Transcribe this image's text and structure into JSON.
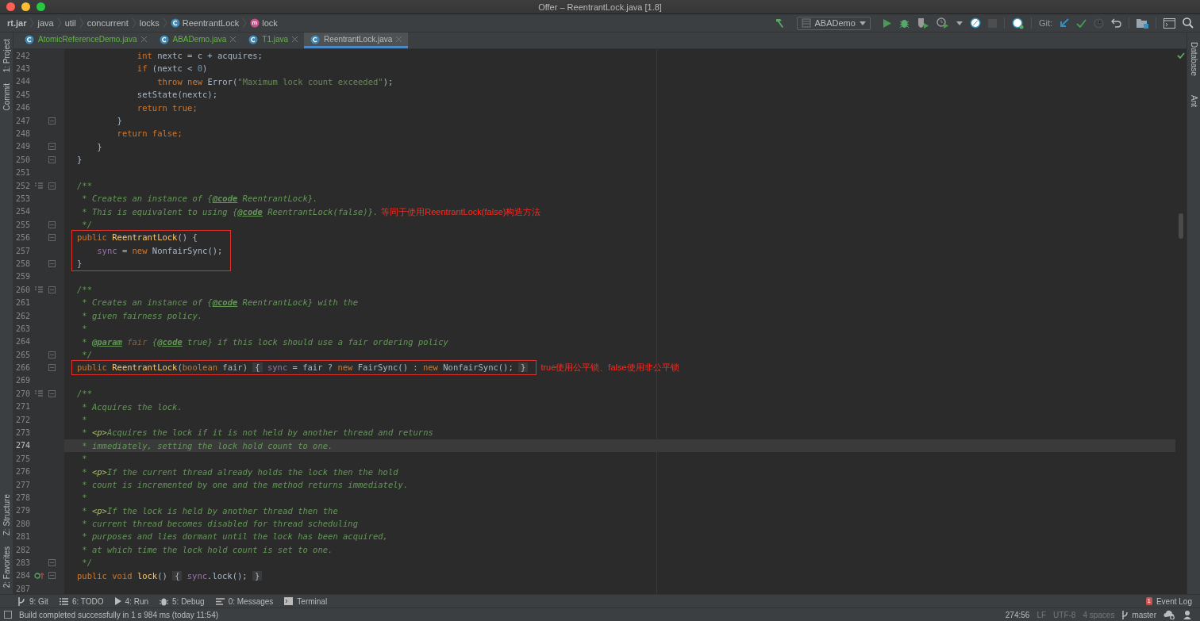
{
  "window": {
    "title": "Offer – ReentrantLock.java [1.8]"
  },
  "breadcrumbs": [
    {
      "label": "rt.jar",
      "kind": "root"
    },
    {
      "label": "java",
      "kind": "package"
    },
    {
      "label": "util",
      "kind": "package"
    },
    {
      "label": "concurrent",
      "kind": "package"
    },
    {
      "label": "locks",
      "kind": "package"
    },
    {
      "label": "ReentrantLock",
      "kind": "class"
    },
    {
      "label": "lock",
      "kind": "method"
    }
  ],
  "toolbar": {
    "run_config": "ABADemo",
    "git_label": "Git:"
  },
  "tabs": [
    {
      "label": "AtomicReferenceDemo.java",
      "selected": false,
      "color": "#62b543"
    },
    {
      "label": "ABADemo.java",
      "selected": false,
      "color": "#62b543"
    },
    {
      "label": "T1.java",
      "selected": false,
      "color": "#62b543"
    },
    {
      "label": "ReentrantLock.java",
      "selected": true,
      "color": "#bbbbbb"
    }
  ],
  "left_tool_windows": {
    "top": [
      "1: Project",
      "Commit"
    ],
    "bottom": [
      "Z: Structure",
      "2: Favorites"
    ]
  },
  "right_tool_windows": [
    "Database",
    "Ant"
  ],
  "editor": {
    "code": [
      {
        "kind": "line",
        "no": "242",
        "tokens": [
          {
            "text": "            int ",
            "kind": "kw"
          },
          {
            "text": "nextc = c + acquires;",
            "kind": "plain"
          }
        ]
      },
      {
        "kind": "line",
        "no": "243",
        "tokens": [
          {
            "text": "            if ",
            "kind": "kw"
          },
          {
            "text": "(nextc < ",
            "kind": "plain"
          },
          {
            "text": "0",
            "kind": "num"
          },
          {
            "text": ")",
            "kind": "plain"
          }
        ]
      },
      {
        "kind": "line",
        "no": "244",
        "tokens": [
          {
            "text": "                throw new ",
            "kind": "kw"
          },
          {
            "text": "Error(",
            "kind": "plain"
          },
          {
            "text": "\"Maximum lock count exceeded\"",
            "kind": "str"
          },
          {
            "text": ");",
            "kind": "plain"
          }
        ]
      },
      {
        "kind": "line",
        "no": "245",
        "tokens": [
          {
            "text": "            setState(nextc);",
            "kind": "plain"
          }
        ]
      },
      {
        "kind": "line",
        "no": "246",
        "tokens": [
          {
            "text": "            return true;",
            "kind": "kw"
          }
        ]
      },
      {
        "kind": "line",
        "no": "247",
        "gutter": [
          {
            "kind": "fold"
          }
        ],
        "tokens": [
          {
            "text": "        }",
            "kind": "plain"
          }
        ]
      },
      {
        "kind": "line",
        "no": "248",
        "tokens": [
          {
            "text": "        return false;",
            "kind": "kw"
          }
        ]
      },
      {
        "kind": "line",
        "no": "249",
        "gutter": [
          {
            "kind": "fold"
          }
        ],
        "tokens": [
          {
            "text": "    }",
            "kind": "plain"
          }
        ]
      },
      {
        "kind": "line",
        "no": "250",
        "gutter": [
          {
            "kind": "fold"
          }
        ],
        "tokens": [
          {
            "text": "}",
            "kind": "plain"
          }
        ]
      },
      {
        "kind": "line",
        "no": "251"
      },
      {
        "kind": "line",
        "no": "252",
        "gutter": [
          {
            "kind": "doc"
          },
          {
            "kind": "fold"
          }
        ],
        "tokens": [
          {
            "text": "/**",
            "kind": "doc"
          }
        ]
      },
      {
        "kind": "line",
        "no": "253",
        "tokens": [
          {
            "text": " * Creates an instance of {",
            "kind": "doc"
          },
          {
            "text": "@code",
            "kind": "doctag"
          },
          {
            "text": " ReentrantLock}.",
            "kind": "doc"
          }
        ]
      },
      {
        "kind": "line",
        "no": "254",
        "tokens": [
          {
            "text": " * This is equivalent to using {",
            "kind": "doc"
          },
          {
            "text": "@code",
            "kind": "doctag"
          },
          {
            "text": " ReentrantLock(false)}.",
            "kind": "doc"
          }
        ],
        "note": "等同于使用ReentrantLock(false)构造方法"
      },
      {
        "kind": "line",
        "no": "255",
        "gutter": [
          {
            "kind": "fold"
          }
        ],
        "tokens": [
          {
            "text": " */",
            "kind": "doc"
          }
        ]
      },
      {
        "kind": "boxed",
        "lines": [
          {
            "no": "256",
            "gutter": [
              {
                "kind": "fold"
              }
            ],
            "tokens": [
              {
                "text": "public ",
                "kind": "kw"
              },
              {
                "text": "ReentrantLock",
                "kind": "method"
              },
              {
                "text": "() {",
                "kind": "plain"
              }
            ]
          },
          {
            "no": "257",
            "tokens": [
              {
                "text": "    sync",
                "kind": "field"
              },
              {
                "text": " = ",
                "kind": "plain"
              },
              {
                "text": "new ",
                "kind": "kw"
              },
              {
                "text": "NonfairSync();",
                "kind": "plain"
              }
            ]
          },
          {
            "no": "258",
            "gutter": [
              {
                "kind": "fold"
              }
            ],
            "tokens": [
              {
                "text": "}",
                "kind": "plain"
              }
            ]
          }
        ]
      },
      {
        "kind": "line",
        "no": "259"
      },
      {
        "kind": "line",
        "no": "260",
        "gutter": [
          {
            "kind": "doc"
          },
          {
            "kind": "fold"
          }
        ],
        "tokens": [
          {
            "text": "/**",
            "kind": "doc"
          }
        ]
      },
      {
        "kind": "line",
        "no": "261",
        "tokens": [
          {
            "text": " * Creates an instance of {",
            "kind": "doc"
          },
          {
            "text": "@code",
            "kind": "doctag"
          },
          {
            "text": " ReentrantLock} with the",
            "kind": "doc"
          }
        ]
      },
      {
        "kind": "line",
        "no": "262",
        "tokens": [
          {
            "text": " * given fairness policy.",
            "kind": "doc"
          }
        ]
      },
      {
        "kind": "line",
        "no": "263",
        "tokens": [
          {
            "text": " *",
            "kind": "doc"
          }
        ]
      },
      {
        "kind": "line",
        "no": "264",
        "tokens": [
          {
            "text": " * ",
            "kind": "doc"
          },
          {
            "text": "@param",
            "kind": "doctag"
          },
          {
            "text": " fair",
            "kind": "docparam"
          },
          {
            "text": " {",
            "kind": "doc"
          },
          {
            "text": "@code",
            "kind": "doctag"
          },
          {
            "text": " true} if this lock should use a fair ordering policy",
            "kind": "doc"
          }
        ]
      },
      {
        "kind": "line",
        "no": "265",
        "gutter": [
          {
            "kind": "fold"
          }
        ],
        "tokens": [
          {
            "text": " */",
            "kind": "doc"
          }
        ]
      },
      {
        "kind": "boxed",
        "note": "true使用公平锁、false使用非公平锁",
        "lines": [
          {
            "no": "266",
            "gutter": [
              {
                "kind": "fold"
              }
            ],
            "tokens": [
              {
                "text": "public ",
                "kind": "kw"
              },
              {
                "text": "ReentrantLock",
                "kind": "method"
              },
              {
                "text": "(",
                "kind": "plain"
              },
              {
                "text": "boolean ",
                "kind": "kw"
              },
              {
                "text": "fair) ",
                "kind": "plain"
              },
              {
                "text": "{",
                "kind": "fold"
              },
              {
                "text": " sync",
                "kind": "field"
              },
              {
                "text": " = fair ? ",
                "kind": "plain"
              },
              {
                "text": "new ",
                "kind": "kw"
              },
              {
                "text": "FairSync() : ",
                "kind": "plain"
              },
              {
                "text": "new ",
                "kind": "kw"
              },
              {
                "text": "NonfairSync(); ",
                "kind": "plain"
              },
              {
                "text": "}",
                "kind": "fold"
              }
            ]
          }
        ]
      },
      {
        "kind": "line",
        "no": "269"
      },
      {
        "kind": "line",
        "no": "270",
        "gutter": [
          {
            "kind": "doc"
          },
          {
            "kind": "fold"
          }
        ],
        "tokens": [
          {
            "text": "/**",
            "kind": "doc"
          }
        ]
      },
      {
        "kind": "line",
        "no": "271",
        "tokens": [
          {
            "text": " * Acquires the lock.",
            "kind": "doc"
          }
        ]
      },
      {
        "kind": "line",
        "no": "272",
        "tokens": [
          {
            "text": " *",
            "kind": "doc"
          }
        ]
      },
      {
        "kind": "line",
        "no": "273",
        "tokens": [
          {
            "text": " * ",
            "kind": "doc"
          },
          {
            "text": "<p>",
            "kind": "dochtml"
          },
          {
            "text": "Acquires the lock if it is not held by another thread and returns",
            "kind": "doc"
          }
        ]
      },
      {
        "kind": "line",
        "no": "274",
        "current": true,
        "tokens": [
          {
            "text": " * immediately, setting the lock hold count to one.",
            "kind": "doc"
          }
        ]
      },
      {
        "kind": "line",
        "no": "275",
        "tokens": [
          {
            "text": " *",
            "kind": "doc"
          }
        ]
      },
      {
        "kind": "line",
        "no": "276",
        "tokens": [
          {
            "text": " * ",
            "kind": "doc"
          },
          {
            "text": "<p>",
            "kind": "dochtml"
          },
          {
            "text": "If the current thread already holds the lock then the hold",
            "kind": "doc"
          }
        ]
      },
      {
        "kind": "line",
        "no": "277",
        "tokens": [
          {
            "text": " * count is incremented by one and the method returns immediately.",
            "kind": "doc"
          }
        ]
      },
      {
        "kind": "line",
        "no": "278",
        "tokens": [
          {
            "text": " *",
            "kind": "doc"
          }
        ]
      },
      {
        "kind": "line",
        "no": "279",
        "tokens": [
          {
            "text": " * ",
            "kind": "doc"
          },
          {
            "text": "<p>",
            "kind": "dochtml"
          },
          {
            "text": "If the lock is held by another thread then the",
            "kind": "doc"
          }
        ]
      },
      {
        "kind": "line",
        "no": "280",
        "tokens": [
          {
            "text": " * current thread becomes disabled for thread scheduling",
            "kind": "doc"
          }
        ]
      },
      {
        "kind": "line",
        "no": "281",
        "tokens": [
          {
            "text": " * purposes and lies dormant until the lock has been acquired,",
            "kind": "doc"
          }
        ]
      },
      {
        "kind": "line",
        "no": "282",
        "tokens": [
          {
            "text": " * at which time the lock hold count is set to one.",
            "kind": "doc"
          }
        ]
      },
      {
        "kind": "line",
        "no": "283",
        "gutter": [
          {
            "kind": "fold"
          }
        ],
        "tokens": [
          {
            "text": " */",
            "kind": "doc"
          }
        ]
      },
      {
        "kind": "line",
        "no": "284",
        "gutter": [
          {
            "kind": "override"
          },
          {
            "kind": "fold"
          }
        ],
        "tokens": [
          {
            "text": "public ",
            "kind": "kw"
          },
          {
            "text": "void ",
            "kind": "kw"
          },
          {
            "text": "lock",
            "kind": "method"
          },
          {
            "text": "() ",
            "kind": "plain"
          },
          {
            "text": "{",
            "kind": "fold"
          },
          {
            "text": " sync",
            "kind": "field"
          },
          {
            "text": ".lock(); ",
            "kind": "plain"
          },
          {
            "text": "}",
            "kind": "fold"
          }
        ]
      },
      {
        "kind": "line",
        "no": "287"
      }
    ]
  },
  "tool_tabs": [
    {
      "label": "9: Git",
      "kind": "git"
    },
    {
      "label": "6: TODO",
      "kind": "todo"
    },
    {
      "label": "4: Run",
      "kind": "run"
    },
    {
      "label": "5: Debug",
      "kind": "debug"
    },
    {
      "label": "0: Messages",
      "kind": "messages"
    },
    {
      "label": "Terminal",
      "kind": "terminal"
    }
  ],
  "event_log": {
    "label": "Event Log",
    "badge": "1"
  },
  "status_bar": {
    "message": "Build completed successfully in 1 s 984 ms (today 11:54)",
    "position": "274:56",
    "line_separator": "LF",
    "encoding": "UTF-8",
    "indent": "4 spaces",
    "branch": "master"
  }
}
